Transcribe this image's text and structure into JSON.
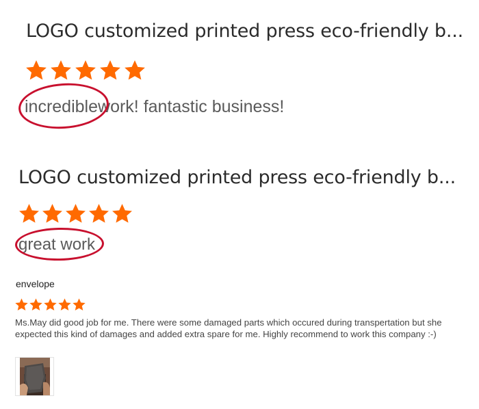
{
  "reviews": [
    {
      "title": "LOGO customized printed press eco-friendly b...",
      "rating": 5,
      "comment_highlight": "incredible",
      "comment_rest": "work! fantastic business!"
    },
    {
      "title": "LOGO customized printed press eco-friendly b...",
      "rating": 5,
      "comment_highlight": "great work",
      "comment_rest": ""
    }
  ],
  "detail_review": {
    "product": "envelope",
    "rating": 5,
    "text": "Ms.May did good job for me. There were some damaged parts which occured during transpertation but she expected this kind of damages and added extra spare for me. Highly recommend to work this company :-)"
  },
  "colors": {
    "star": "#ff6a00",
    "highlight_oval": "#c8102e"
  }
}
